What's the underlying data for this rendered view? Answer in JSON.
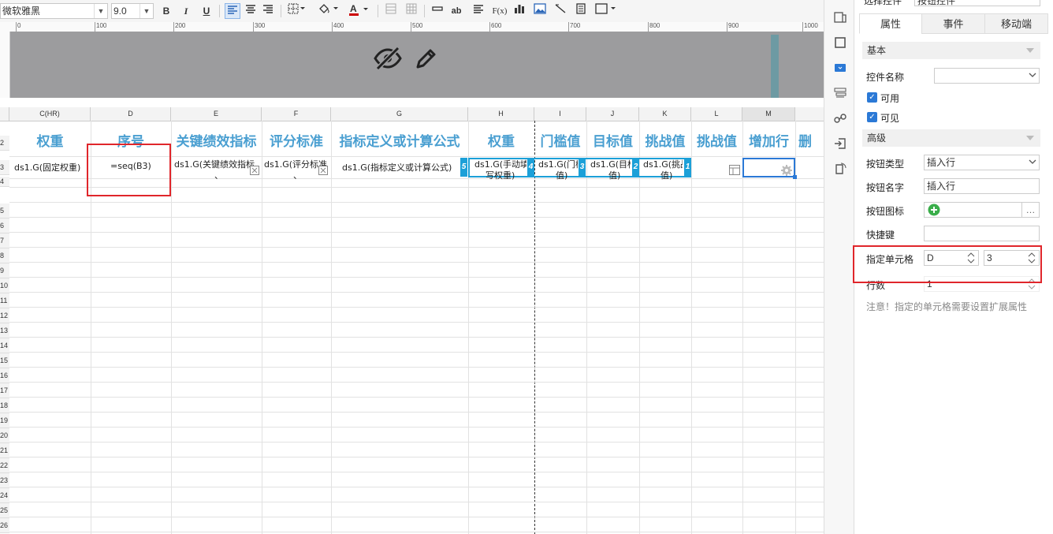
{
  "toolbar": {
    "font_name": "微软雅黑",
    "font_size": "9.0",
    "bold": "B",
    "italic": "I",
    "underline": "U",
    "formula": "F(x)",
    "ab": "ab"
  },
  "ruler": {
    "marks": [
      "0",
      "100",
      "200",
      "300",
      "400",
      "500",
      "600",
      "700",
      "800",
      "900",
      "1000"
    ]
  },
  "grid": {
    "columns": [
      "C(HR)",
      "D",
      "E",
      "F",
      "G",
      "H",
      "I",
      "J",
      "K",
      "L",
      "M"
    ],
    "row_numbers": [
      "2",
      "3",
      "4",
      "5",
      "6",
      "7",
      "8",
      "9",
      "10",
      "11",
      "12",
      "13",
      "14",
      "15",
      "16",
      "17",
      "18",
      "19",
      "20",
      "21",
      "22",
      "23",
      "24",
      "25",
      "26",
      "27"
    ],
    "titles": [
      "权重",
      "序号",
      "关键绩效指标",
      "评分标准",
      "指标定义或计算公式",
      "权重",
      "门槛值",
      "目标值",
      "挑战值",
      "挑战值",
      "增加行",
      "删"
    ],
    "data_row": {
      "c": "ds1.G(固定权重)",
      "d": "=seq(B3)",
      "e": "ds1.G(关键绩效指标",
      "e2": "、",
      "f": "ds1.G(评分标准",
      "f2": "、",
      "g": "ds1.G(指标定义或计算公式)",
      "h": "ds1.G(手动填",
      "h2": "写权重)",
      "i": "ds1.G(门槛",
      "i2": "值)",
      "j": "ds1.G(目标",
      "j2": "值)",
      "k": "ds1.G(挑战",
      "k2": "值)"
    },
    "badges": [
      "5",
      "4",
      "3",
      "2",
      "1"
    ]
  },
  "panel": {
    "top_label": "选择控件",
    "top_value": "按钮控件",
    "tabs": [
      "属性",
      "事件",
      "移动端"
    ],
    "section_basic": "基本",
    "control_name_label": "控件名称",
    "control_name_value": "",
    "enabled_label": "可用",
    "visible_label": "可见",
    "section_advanced": "高级",
    "button_type_label": "按钮类型",
    "button_type_value": "插入行",
    "button_name_label": "按钮名字",
    "button_name_value": "插入行",
    "button_icon_label": "按钮图标",
    "button_icon_more": "…",
    "shortcut_label": "快捷键",
    "shortcut_value": "",
    "cell_label": "指定单元格",
    "cell_col": "D",
    "cell_row": "3",
    "rows_label": "行数",
    "rows_value": "1",
    "note": "注意！指定的单元格需要设置扩展属性"
  },
  "colors": {
    "title_blue": "#4a9fd1",
    "badge_cyan": "#1ca0d8",
    "highlight_red": "#e0262b",
    "header_gray": "#9c9c9e",
    "check_blue": "#2b79d6"
  }
}
